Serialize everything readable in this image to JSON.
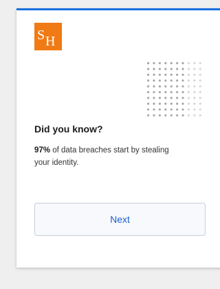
{
  "brand": {
    "logo_icon": "sh-logo-icon",
    "accent_color": "#1a6fe0",
    "logo_color": "#f07a14"
  },
  "decoration": {
    "icon": "dot-grid-icon"
  },
  "content": {
    "headline": "Did you know?",
    "fact_stat": "97%",
    "fact_text": " of data breaches start by stealing your identity."
  },
  "actions": {
    "next_label": "Next",
    "button_text_color": "#1a5fd0"
  }
}
